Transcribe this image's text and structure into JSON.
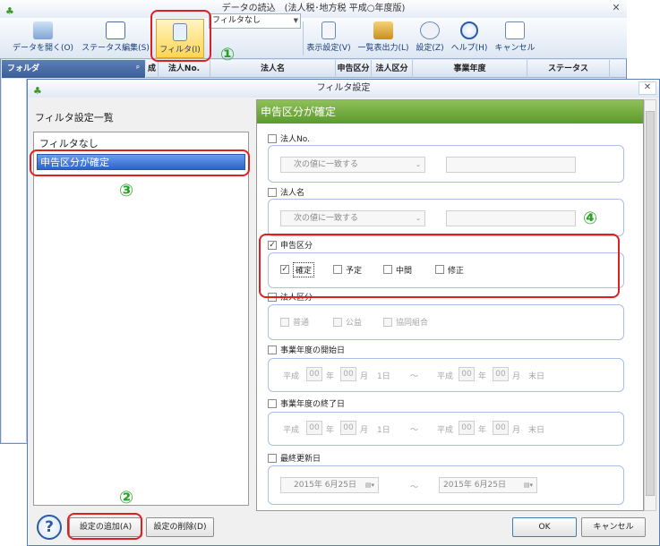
{
  "bg_window": {
    "title": "データの読込　(法人税･地方税 平成○年度版)",
    "close": "✕",
    "ribbon": [
      {
        "label": "データを開く(O)",
        "icon": "open-data-icon"
      },
      {
        "label": "ステータス編集(S)",
        "icon": "status-edit-icon"
      },
      {
        "label": "フィルタ(I)",
        "icon": "filter-icon"
      },
      {
        "label": "表示設定(V)",
        "icon": "display-settings-icon"
      },
      {
        "label": "一覧表出力(L)",
        "icon": "list-export-icon"
      },
      {
        "label": "設定(Z)",
        "icon": "settings-icon"
      },
      {
        "label": "ヘルプ(H)",
        "icon": "help-icon"
      },
      {
        "label": "キャンセル",
        "icon": "cancel-icon"
      }
    ],
    "filter_select": "フィルタなし",
    "folder_label": "フォルダ",
    "folder_pin": "ᵖ",
    "columns": [
      "成",
      "法人No.",
      "法人名",
      "申告区分",
      "法人区分",
      "事業年度",
      "ステータス"
    ]
  },
  "annotations": {
    "n1": "①",
    "n2": "②",
    "n3": "③",
    "n4": "④"
  },
  "dialog": {
    "title": "フィルタ設定",
    "close": "✕",
    "list_heading": "フィルタ設定一覧",
    "list_items": [
      "フィルタなし",
      "申告区分が確定"
    ],
    "panel_title": "申告区分が確定",
    "sections": {
      "corp_no": {
        "label": "法人No.",
        "checked": false,
        "select": "次の値に一致する"
      },
      "corp_name": {
        "label": "法人名",
        "checked": false,
        "select": "次の値に一致する"
      },
      "filing": {
        "label": "申告区分",
        "checked": true,
        "options": [
          {
            "label": "確定",
            "checked": true
          },
          {
            "label": "予定",
            "checked": false
          },
          {
            "label": "中間",
            "checked": false
          },
          {
            "label": "修正",
            "checked": false
          }
        ]
      },
      "corp_type": {
        "label": "法人区分",
        "checked": false,
        "options": [
          {
            "label": "普通",
            "checked": false
          },
          {
            "label": "公益",
            "checked": false
          },
          {
            "label": "協同組合",
            "checked": false
          }
        ]
      },
      "fy_start": {
        "label": "事業年度の開始日",
        "checked": false,
        "era": "平成",
        "yy": "00",
        "year_unit": "年",
        "mm": "00",
        "month_unit": "月",
        "day": "1日",
        "tilde": "～",
        "era2": "平成",
        "yy2": "00",
        "mm2": "00",
        "end": "末日"
      },
      "fy_end": {
        "label": "事業年度の終了日",
        "checked": false,
        "era": "平成",
        "yy": "00",
        "year_unit": "年",
        "mm": "00",
        "month_unit": "月",
        "day": "1日",
        "tilde": "～",
        "era2": "平成",
        "yy2": "00",
        "mm2": "00",
        "end": "末日"
      },
      "updated": {
        "label": "最終更新日",
        "checked": false,
        "from": "2015年 6月25日",
        "tilde": "～",
        "to": "2015年 6月25日"
      }
    },
    "buttons": {
      "help": "?",
      "add": "設定の追加(A)",
      "delete": "設定の削除(D)",
      "ok": "OK",
      "cancel": "キャンセル"
    },
    "check_mark": "✓"
  }
}
